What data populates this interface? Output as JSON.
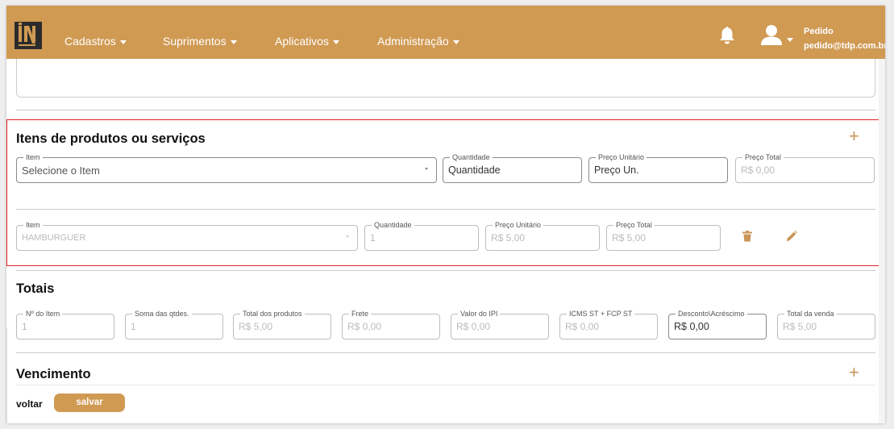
{
  "navbar": {
    "menus": [
      {
        "label": "Cadastros"
      },
      {
        "label": "Suprimentos"
      },
      {
        "label": "Aplicativos"
      },
      {
        "label": "Administração"
      }
    ],
    "user_name": "Pedido",
    "user_email": "pedido@tdp.com.br"
  },
  "items_section": {
    "title": "Itens de produtos ou serviços",
    "new_item": {
      "item_label": "Item",
      "item_value": "Selecione o Item",
      "qty_label": "Quantidade",
      "qty_value": "Quantidade",
      "unit_price_label": "Preço Unitário",
      "unit_price_value": "Preço Un.",
      "total_label": "Preço Total",
      "total_value": "R$ 0,00"
    },
    "rows": [
      {
        "item_label": "Item",
        "item_value": "HAMBURGUER",
        "qty_label": "Quantidade",
        "qty_value": "1",
        "unit_price_label": "Preço Unitário",
        "unit_price_value": "R$ 5,00",
        "total_label": "Preço Total",
        "total_value": "R$ 5,00"
      }
    ]
  },
  "totals": {
    "title": "Totais",
    "fields": [
      {
        "label": "Nº do Item",
        "value": "1"
      },
      {
        "label": "Soma das qtdes.",
        "value": "1"
      },
      {
        "label": "Total dos produtos",
        "value": "R$ 5,00"
      },
      {
        "label": "Frete",
        "value": "R$ 0,00"
      },
      {
        "label": "Valor do IPI",
        "value": "R$ 0,00"
      },
      {
        "label": "ICMS ST + FCP ST",
        "value": "R$ 0,00"
      },
      {
        "label": "Desconto\\Acréscimo",
        "value": "R$ 0,00"
      },
      {
        "label": "Total da venda",
        "value": "R$ 5,00"
      }
    ]
  },
  "vencimento": {
    "title": "Vencimento"
  },
  "footer": {
    "back_label": "voltar",
    "save_label": "salvar"
  },
  "colors": {
    "brand": "#d09a53",
    "accent_icon": "#c8955a",
    "highlight": "#e02424"
  },
  "icons": [
    "logo-icon",
    "caret-down-icon",
    "bell-icon",
    "user-icon",
    "plus-icon",
    "trash-icon",
    "pencil-icon"
  ]
}
